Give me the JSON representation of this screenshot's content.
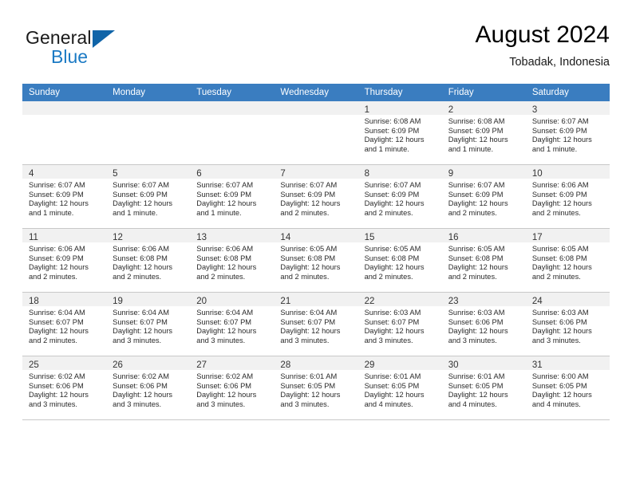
{
  "brand": {
    "name_part1": "General",
    "name_part2": "Blue",
    "logo_icon": "triangle-logo-icon"
  },
  "header": {
    "month_title": "August 2024",
    "location": "Tobadak, Indonesia"
  },
  "weekday_headers": [
    "Sunday",
    "Monday",
    "Tuesday",
    "Wednesday",
    "Thursday",
    "Friday",
    "Saturday"
  ],
  "colors": {
    "header_blue": "#3a7dc0",
    "brand_blue": "#1b7ac4",
    "logo_blue": "#1064a8",
    "cell_band": "#f1f1f1",
    "grid_line": "#c8c8c8"
  },
  "weeks": [
    [
      {
        "day": "",
        "lines": []
      },
      {
        "day": "",
        "lines": []
      },
      {
        "day": "",
        "lines": []
      },
      {
        "day": "",
        "lines": []
      },
      {
        "day": "1",
        "lines": [
          "Sunrise: 6:08 AM",
          "Sunset: 6:09 PM",
          "Daylight: 12 hours",
          "and 1 minute."
        ]
      },
      {
        "day": "2",
        "lines": [
          "Sunrise: 6:08 AM",
          "Sunset: 6:09 PM",
          "Daylight: 12 hours",
          "and 1 minute."
        ]
      },
      {
        "day": "3",
        "lines": [
          "Sunrise: 6:07 AM",
          "Sunset: 6:09 PM",
          "Daylight: 12 hours",
          "and 1 minute."
        ]
      }
    ],
    [
      {
        "day": "4",
        "lines": [
          "Sunrise: 6:07 AM",
          "Sunset: 6:09 PM",
          "Daylight: 12 hours",
          "and 1 minute."
        ]
      },
      {
        "day": "5",
        "lines": [
          "Sunrise: 6:07 AM",
          "Sunset: 6:09 PM",
          "Daylight: 12 hours",
          "and 1 minute."
        ]
      },
      {
        "day": "6",
        "lines": [
          "Sunrise: 6:07 AM",
          "Sunset: 6:09 PM",
          "Daylight: 12 hours",
          "and 1 minute."
        ]
      },
      {
        "day": "7",
        "lines": [
          "Sunrise: 6:07 AM",
          "Sunset: 6:09 PM",
          "Daylight: 12 hours",
          "and 2 minutes."
        ]
      },
      {
        "day": "8",
        "lines": [
          "Sunrise: 6:07 AM",
          "Sunset: 6:09 PM",
          "Daylight: 12 hours",
          "and 2 minutes."
        ]
      },
      {
        "day": "9",
        "lines": [
          "Sunrise: 6:07 AM",
          "Sunset: 6:09 PM",
          "Daylight: 12 hours",
          "and 2 minutes."
        ]
      },
      {
        "day": "10",
        "lines": [
          "Sunrise: 6:06 AM",
          "Sunset: 6:09 PM",
          "Daylight: 12 hours",
          "and 2 minutes."
        ]
      }
    ],
    [
      {
        "day": "11",
        "lines": [
          "Sunrise: 6:06 AM",
          "Sunset: 6:09 PM",
          "Daylight: 12 hours",
          "and 2 minutes."
        ]
      },
      {
        "day": "12",
        "lines": [
          "Sunrise: 6:06 AM",
          "Sunset: 6:08 PM",
          "Daylight: 12 hours",
          "and 2 minutes."
        ]
      },
      {
        "day": "13",
        "lines": [
          "Sunrise: 6:06 AM",
          "Sunset: 6:08 PM",
          "Daylight: 12 hours",
          "and 2 minutes."
        ]
      },
      {
        "day": "14",
        "lines": [
          "Sunrise: 6:05 AM",
          "Sunset: 6:08 PM",
          "Daylight: 12 hours",
          "and 2 minutes."
        ]
      },
      {
        "day": "15",
        "lines": [
          "Sunrise: 6:05 AM",
          "Sunset: 6:08 PM",
          "Daylight: 12 hours",
          "and 2 minutes."
        ]
      },
      {
        "day": "16",
        "lines": [
          "Sunrise: 6:05 AM",
          "Sunset: 6:08 PM",
          "Daylight: 12 hours",
          "and 2 minutes."
        ]
      },
      {
        "day": "17",
        "lines": [
          "Sunrise: 6:05 AM",
          "Sunset: 6:08 PM",
          "Daylight: 12 hours",
          "and 2 minutes."
        ]
      }
    ],
    [
      {
        "day": "18",
        "lines": [
          "Sunrise: 6:04 AM",
          "Sunset: 6:07 PM",
          "Daylight: 12 hours",
          "and 2 minutes."
        ]
      },
      {
        "day": "19",
        "lines": [
          "Sunrise: 6:04 AM",
          "Sunset: 6:07 PM",
          "Daylight: 12 hours",
          "and 3 minutes."
        ]
      },
      {
        "day": "20",
        "lines": [
          "Sunrise: 6:04 AM",
          "Sunset: 6:07 PM",
          "Daylight: 12 hours",
          "and 3 minutes."
        ]
      },
      {
        "day": "21",
        "lines": [
          "Sunrise: 6:04 AM",
          "Sunset: 6:07 PM",
          "Daylight: 12 hours",
          "and 3 minutes."
        ]
      },
      {
        "day": "22",
        "lines": [
          "Sunrise: 6:03 AM",
          "Sunset: 6:07 PM",
          "Daylight: 12 hours",
          "and 3 minutes."
        ]
      },
      {
        "day": "23",
        "lines": [
          "Sunrise: 6:03 AM",
          "Sunset: 6:06 PM",
          "Daylight: 12 hours",
          "and 3 minutes."
        ]
      },
      {
        "day": "24",
        "lines": [
          "Sunrise: 6:03 AM",
          "Sunset: 6:06 PM",
          "Daylight: 12 hours",
          "and 3 minutes."
        ]
      }
    ],
    [
      {
        "day": "25",
        "lines": [
          "Sunrise: 6:02 AM",
          "Sunset: 6:06 PM",
          "Daylight: 12 hours",
          "and 3 minutes."
        ]
      },
      {
        "day": "26",
        "lines": [
          "Sunrise: 6:02 AM",
          "Sunset: 6:06 PM",
          "Daylight: 12 hours",
          "and 3 minutes."
        ]
      },
      {
        "day": "27",
        "lines": [
          "Sunrise: 6:02 AM",
          "Sunset: 6:06 PM",
          "Daylight: 12 hours",
          "and 3 minutes."
        ]
      },
      {
        "day": "28",
        "lines": [
          "Sunrise: 6:01 AM",
          "Sunset: 6:05 PM",
          "Daylight: 12 hours",
          "and 3 minutes."
        ]
      },
      {
        "day": "29",
        "lines": [
          "Sunrise: 6:01 AM",
          "Sunset: 6:05 PM",
          "Daylight: 12 hours",
          "and 4 minutes."
        ]
      },
      {
        "day": "30",
        "lines": [
          "Sunrise: 6:01 AM",
          "Sunset: 6:05 PM",
          "Daylight: 12 hours",
          "and 4 minutes."
        ]
      },
      {
        "day": "31",
        "lines": [
          "Sunrise: 6:00 AM",
          "Sunset: 6:05 PM",
          "Daylight: 12 hours",
          "and 4 minutes."
        ]
      }
    ]
  ]
}
